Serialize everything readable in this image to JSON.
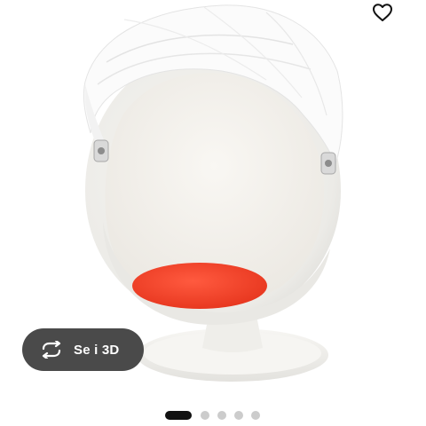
{
  "product": {
    "image_alt": "Chair",
    "colors": {
      "shell": "#f2f1ee",
      "inner": "#f7f5f1",
      "canopy": "#fbfbfb",
      "cushion": "#f0432b",
      "base": "#f4f3f0"
    }
  },
  "favorite": {
    "icon": "heart-outline-icon"
  },
  "view_3d": {
    "label": "Se i 3D",
    "icon": "rotate-arrows-icon",
    "background": "#4a4a4a"
  },
  "carousel": {
    "total": 5,
    "active_index": 0
  }
}
